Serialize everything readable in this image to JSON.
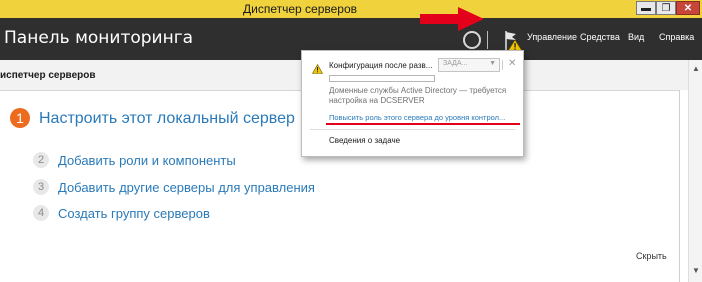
{
  "window": {
    "title": "Диспетчер серверов",
    "controls": {
      "minimize": "▬",
      "maximize": "❐",
      "close": "✕"
    }
  },
  "header": {
    "title": "Панель мониторинга",
    "menu": [
      "Управление",
      "Средства",
      "Вид",
      "Справка"
    ]
  },
  "subbar": {
    "breadcrumb": "испетчер серверов"
  },
  "welcome": {
    "step1": {
      "number": "1",
      "label": "Настроить этот локальный сервер"
    },
    "steps": [
      {
        "number": "2",
        "label": "Добавить роли и компоненты"
      },
      {
        "number": "3",
        "label": "Добавить другие серверы для управления"
      },
      {
        "number": "4",
        "label": "Создать группу серверов"
      }
    ],
    "hide_label": "Скрыть"
  },
  "notification": {
    "title": "Конфигурация после разв...",
    "task_button": "ЗАДА...",
    "description_line1": "Доменные службы Active Directory — требуется",
    "description_line2": "настройка на DCSERVER",
    "link": "Повысить роль этого сервера до уровня контрол...",
    "task_details": "Сведения о задаче"
  },
  "colors": {
    "accent": "#2a7ab9",
    "step_active": "#ec6b1f",
    "header_bg": "#2f2f2f",
    "titlebar_bg": "#f0d23c",
    "annotation_red": "#e3001b"
  },
  "icons": {
    "flag": "flag-warning-icon",
    "refresh": "refresh-icon",
    "warning": "warning-icon",
    "annotation": "red-arrow-icon"
  }
}
